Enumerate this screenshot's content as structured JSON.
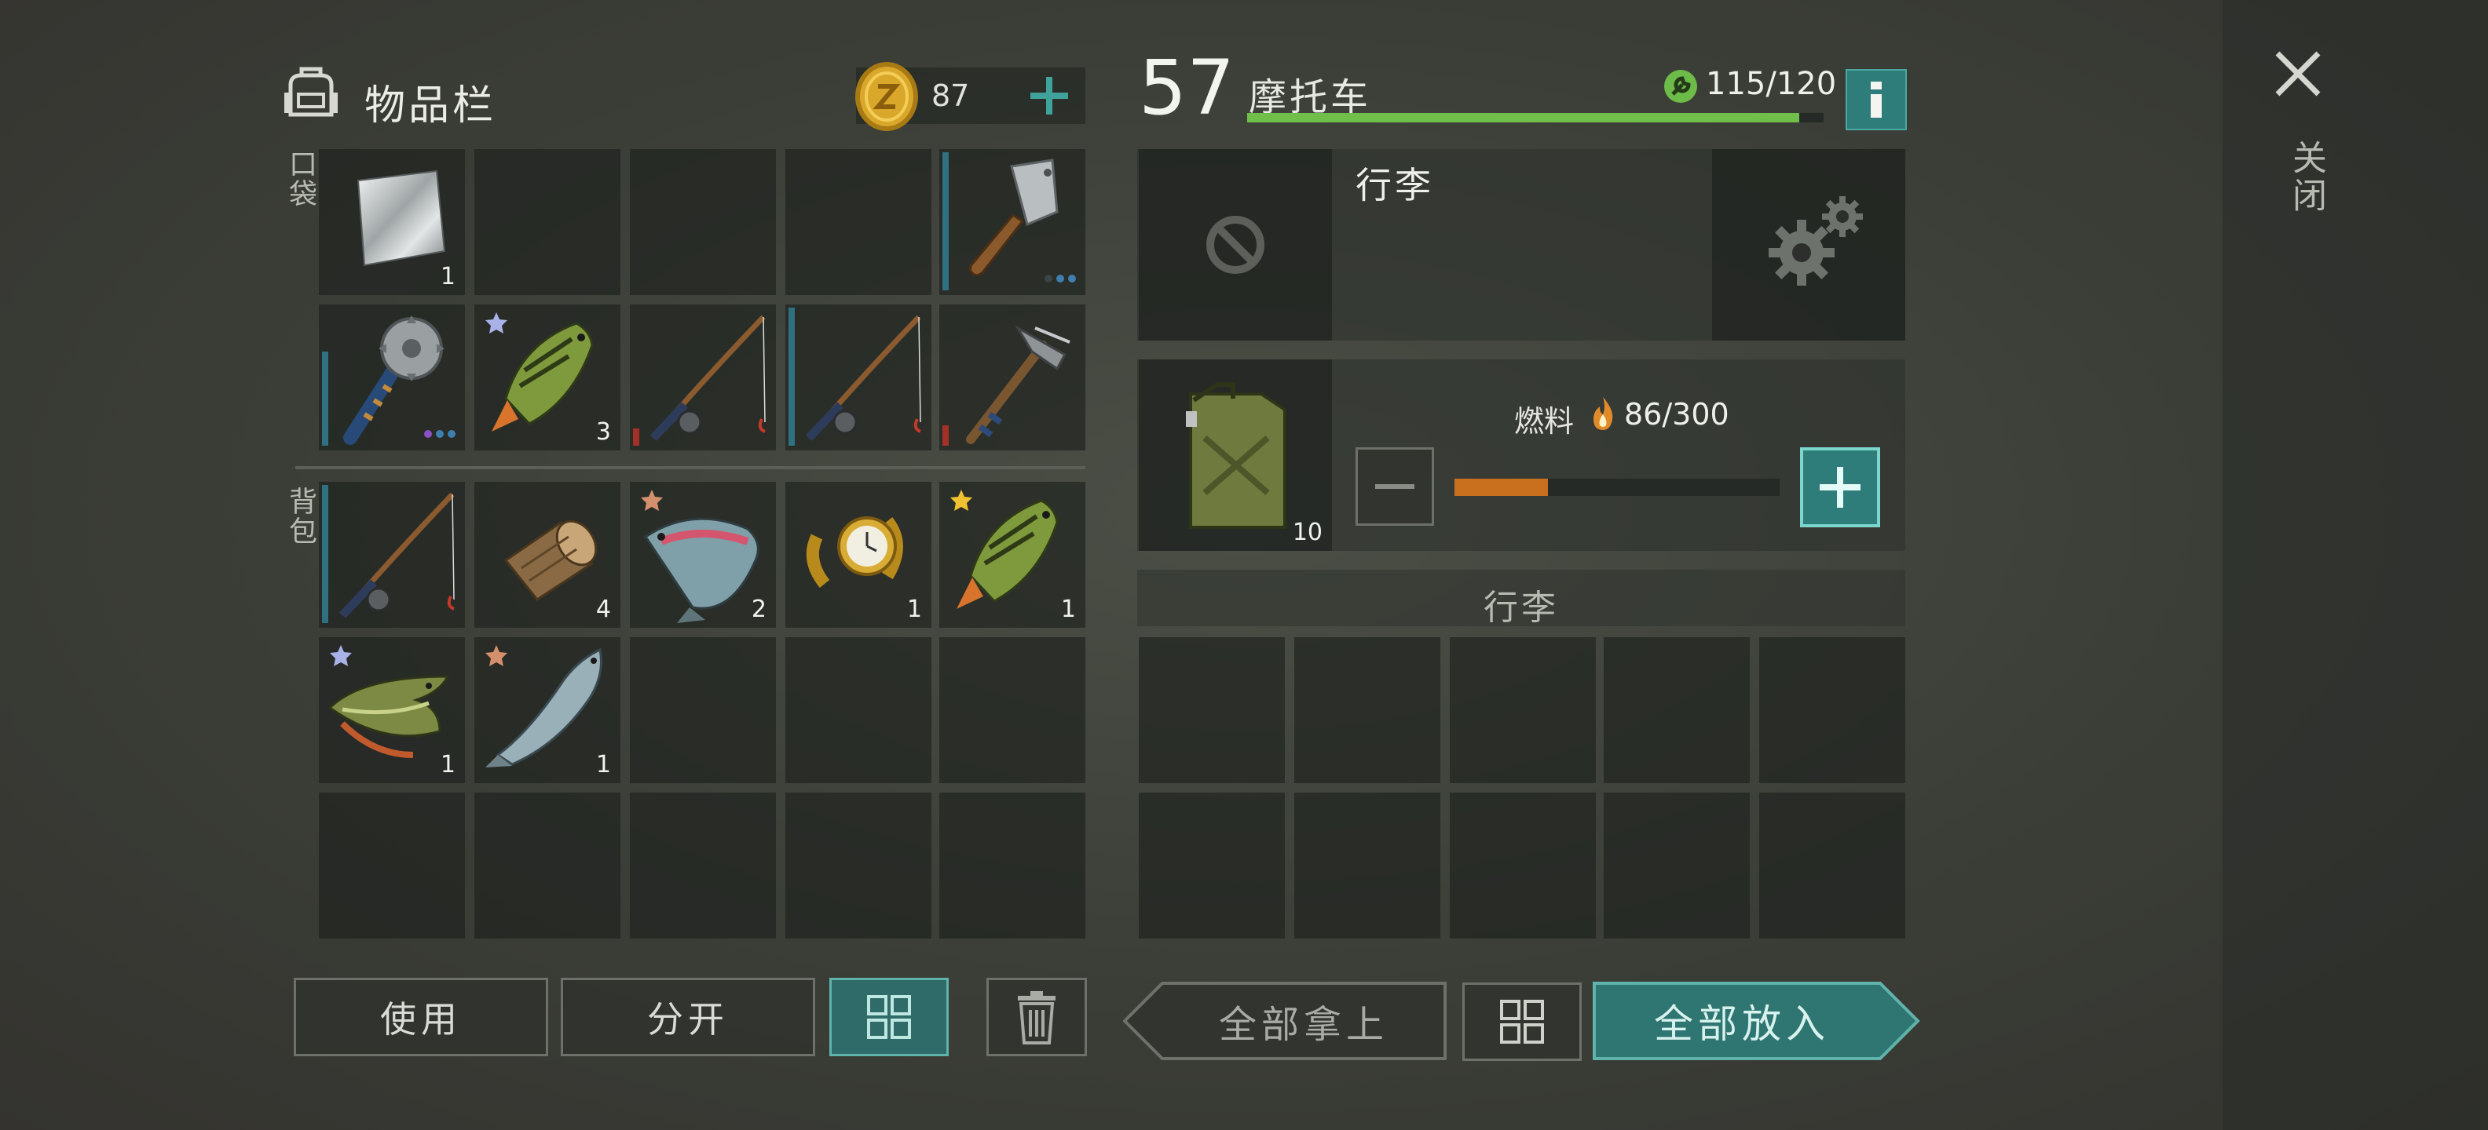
{
  "inventory": {
    "title": "物品栏",
    "coins": "87",
    "pockets_label": "口袋",
    "backpack_label": "背包",
    "slots": {
      "p1_count": "1",
      "p7_count": "3",
      "b2_count": "4",
      "b3_count": "2",
      "b4_count": "1",
      "b5_count": "1",
      "b6_count": "1",
      "b7_count": "1"
    }
  },
  "vehicle": {
    "level": "57",
    "name": "摩托车",
    "durability": "115/120",
    "durability_fraction": 0.958,
    "luggage_title": "行李",
    "fuel_label": "燃料",
    "fuel_value": "86/300",
    "fuel_fraction": 0.287,
    "fuel_item_count": "10",
    "storage_header": "行李"
  },
  "buttons": {
    "use": "使用",
    "split": "分开",
    "take_all": "全部拿上",
    "put_all": "全部放入"
  },
  "close_label": "关闭",
  "colors": {
    "accent_teal": "#3a8c86",
    "durability_green": "#6fbf4a",
    "fuel_orange": "#c9701e"
  }
}
